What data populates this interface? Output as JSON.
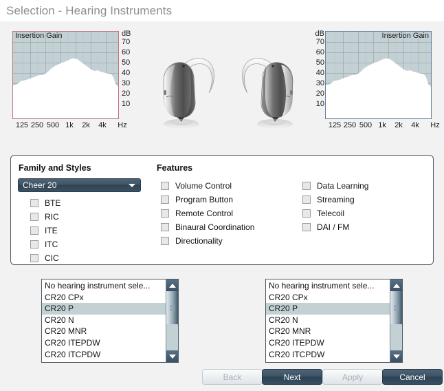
{
  "window": {
    "title": "Selection - Hearing Instruments"
  },
  "charts": {
    "left": {
      "label": "Insertion Gain",
      "border_color": "#c0737c"
    },
    "right": {
      "label": "Insertion Gain",
      "border_color": "#63809d"
    },
    "y_unit": "dB",
    "y_ticks": [
      "70",
      "60",
      "50",
      "40",
      "30",
      "20",
      "10"
    ],
    "x_ticks": [
      "125",
      "250",
      "500",
      "1k",
      "2k",
      "4k"
    ],
    "x_unit": "Hz"
  },
  "chart_data": {
    "type": "area",
    "title": "Insertion Gain",
    "xlabel": "Hz",
    "ylabel": "dB",
    "ylim": [
      0,
      80
    ],
    "y_ticks": [
      10,
      20,
      30,
      40,
      50,
      60,
      70
    ],
    "x": [
      "125",
      "250",
      "500",
      "1k",
      "2k",
      "4k"
    ],
    "x_tick_labels": [
      "125",
      "250",
      "500",
      "1k",
      "2k",
      "4k",
      "Hz"
    ],
    "grid": true,
    "legend": "none",
    "series": [
      {
        "name": "Insertion Gain",
        "values": [
          38,
          41,
          44,
          45,
          47,
          49,
          52,
          54,
          56,
          58,
          60,
          60,
          58,
          55,
          52,
          48,
          46,
          45,
          44,
          42,
          30
        ]
      }
    ],
    "notes": "Shaded upper region above the white gain curve; curve peaks near 60 dB around 1k-2k Hz and drops sharply at the high-frequency end."
  },
  "devices": {
    "left_aid": "bte-hearing-aid-left",
    "right_aid": "bte-hearing-aid-right"
  },
  "panel": {
    "family_title": "Family and Styles",
    "features_title": "Features",
    "family_dropdown": {
      "value": "Cheer 20",
      "options": [
        "Cheer 20"
      ]
    },
    "styles": [
      {
        "label": "BTE",
        "checked": false
      },
      {
        "label": "RIC",
        "checked": false
      },
      {
        "label": "ITE",
        "checked": false
      },
      {
        "label": "ITC",
        "checked": false
      },
      {
        "label": "CIC",
        "checked": false
      }
    ],
    "features_col1": [
      {
        "label": "Volume Control",
        "checked": false
      },
      {
        "label": "Program Button",
        "checked": false
      },
      {
        "label": "Remote Control",
        "checked": false
      },
      {
        "label": "Binaural Coordination",
        "checked": false
      },
      {
        "label": "Directionality",
        "checked": false
      }
    ],
    "features_col2": [
      {
        "label": "Data Learning",
        "checked": false
      },
      {
        "label": "Streaming",
        "checked": false
      },
      {
        "label": "Telecoil",
        "checked": false
      },
      {
        "label": "DAI / FM",
        "checked": false
      }
    ]
  },
  "lists": {
    "left": {
      "items": [
        {
          "label": "No hearing instrument sele...",
          "selected": false
        },
        {
          "label": "CR20 CPx",
          "selected": false
        },
        {
          "label": "CR20 P",
          "selected": true
        },
        {
          "label": "CR20 N",
          "selected": false
        },
        {
          "label": "CR20 MNR",
          "selected": false
        },
        {
          "label": "CR20 ITEPDW",
          "selected": false
        },
        {
          "label": "CR20 ITCPDW",
          "selected": false
        }
      ]
    },
    "right": {
      "items": [
        {
          "label": "No hearing instrument sele...",
          "selected": false
        },
        {
          "label": "CR20 CPx",
          "selected": false
        },
        {
          "label": "CR20 P",
          "selected": true
        },
        {
          "label": "CR20 N",
          "selected": false
        },
        {
          "label": "CR20 MNR",
          "selected": false
        },
        {
          "label": "CR20 ITEPDW",
          "selected": false
        },
        {
          "label": "CR20 ITCPDW",
          "selected": false
        }
      ]
    }
  },
  "buttons": {
    "back": {
      "label": "Back",
      "enabled": false
    },
    "next": {
      "label": "Next",
      "enabled": true
    },
    "apply": {
      "label": "Apply",
      "enabled": false
    },
    "cancel": {
      "label": "Cancel",
      "enabled": true
    }
  },
  "colors": {
    "accent": "#3b5164",
    "chart_shade": "#c3d0d4",
    "selection": "#c3d0d4",
    "panel_border": "#4c5a66",
    "title_text": "#8f8f8f"
  }
}
